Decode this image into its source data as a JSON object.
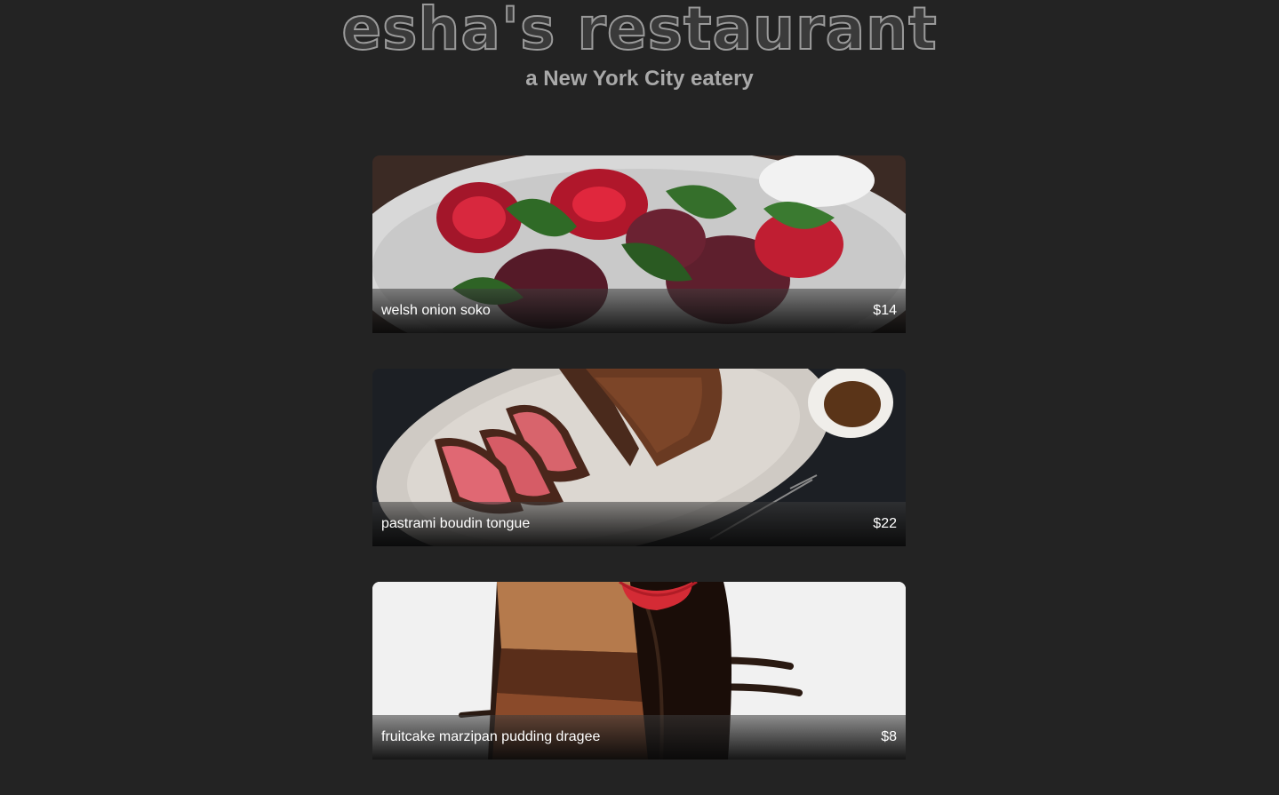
{
  "header": {
    "title": "esha's restaurant",
    "subtitle": "a New York City eatery"
  },
  "menu": {
    "items": [
      {
        "name": "welsh onion soko",
        "price": "$14",
        "photo_icon": "roasted-beets-photo"
      },
      {
        "name": "pastrami boudin tongue",
        "price": "$22",
        "photo_icon": "sliced-steak-photo"
      },
      {
        "name": "fruitcake marzipan pudding dragee",
        "price": "$8",
        "photo_icon": "chocolate-cake-photo"
      }
    ]
  }
}
